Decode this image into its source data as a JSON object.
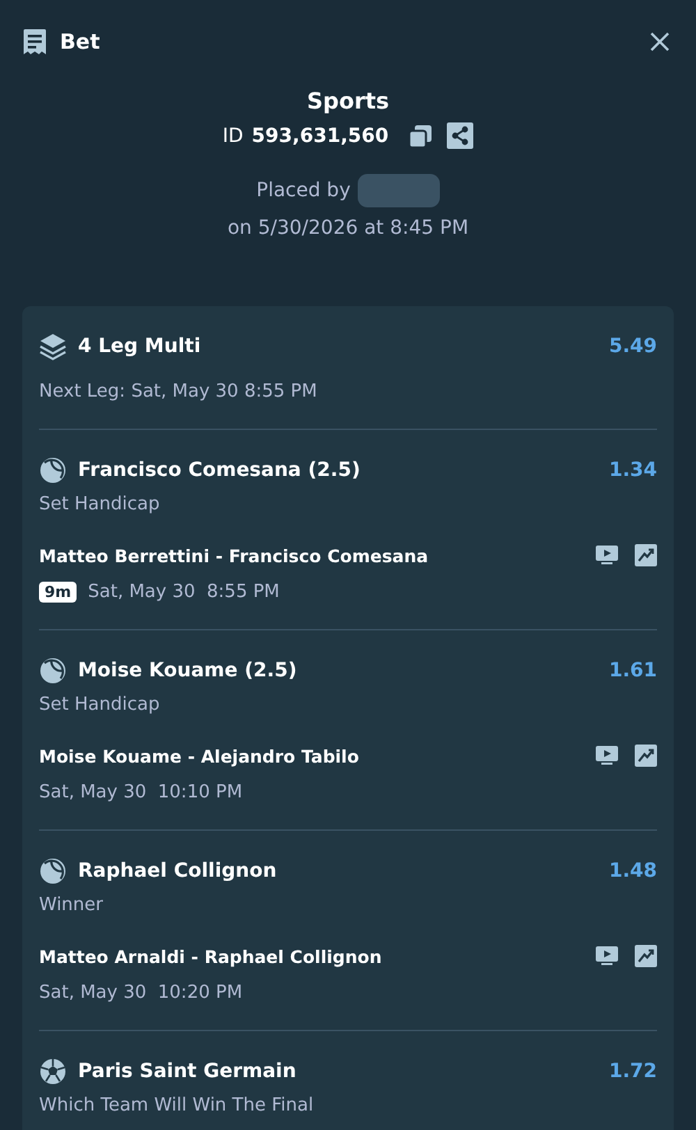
{
  "header": {
    "title": "Bet"
  },
  "summary": {
    "category": "Sports",
    "id_label": "ID",
    "id_value": "593,631,560",
    "placed_by_label": "Placed by",
    "placed_on": "on 5/30/2026 at 8:45 PM"
  },
  "multi": {
    "title": "4 Leg Multi",
    "odds": "5.49",
    "next_leg": "Next Leg: Sat, May 30 8:55 PM"
  },
  "legs": [
    {
      "kind": "tennis",
      "selection": "Francisco Comesana (2.5)",
      "odds": "1.34",
      "market": "Set Handicap",
      "match": "Matteo Berrettini - Francisco Comesana",
      "badge": "9m",
      "time": "Sat, May 30  8:55 PM"
    },
    {
      "kind": "tennis",
      "selection": "Moise Kouame (2.5)",
      "odds": "1.61",
      "market": "Set Handicap",
      "match": "Moise Kouame - Alejandro Tabilo",
      "time": "Sat, May 30  10:10 PM"
    },
    {
      "kind": "tennis",
      "selection": "Raphael Collignon",
      "odds": "1.48",
      "market": "Winner",
      "match": "Matteo Arnaldi - Raphael Collignon",
      "time": "Sat, May 30  10:20 PM"
    },
    {
      "kind": "soccer",
      "selection": "Paris Saint Germain",
      "odds": "1.72",
      "market": "Which Team Will Win The Final"
    }
  ]
}
